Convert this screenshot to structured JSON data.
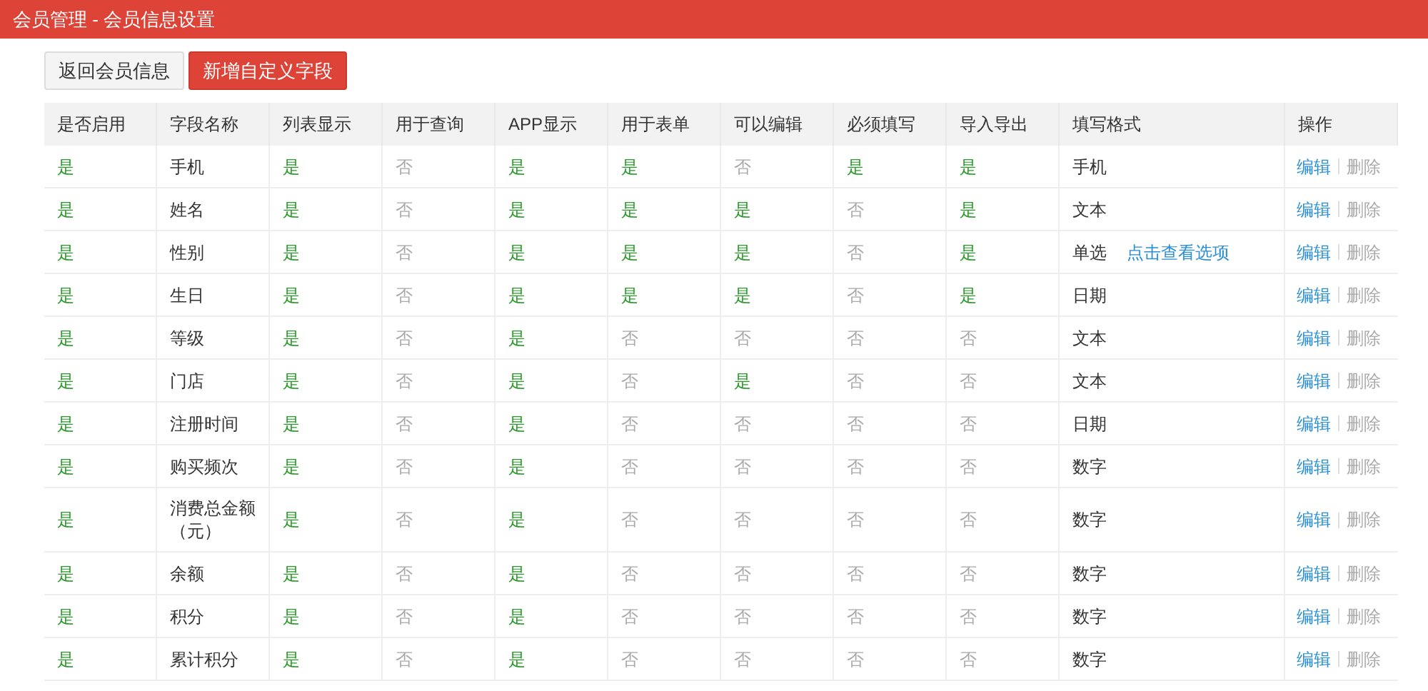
{
  "header": {
    "title": "会员管理 - 会员信息设置"
  },
  "buttons": [
    {
      "label": "返回会员信息",
      "kind": "default"
    },
    {
      "label": "新增自定义字段",
      "kind": "primary"
    }
  ],
  "table": {
    "columns": [
      "是否启用",
      "字段名称",
      "列表显示",
      "用于查询",
      "APP显示",
      "用于表单",
      "可以编辑",
      "必须填写",
      "导入导出",
      "填写格式",
      "操作"
    ],
    "rows": [
      {
        "flags_a": [
          {
            "text": "是",
            "on": true
          }
        ],
        "name": "手机",
        "flags": [
          {
            "text": "是",
            "on": true
          },
          {
            "text": "否",
            "on": false
          },
          {
            "text": "是",
            "on": true
          },
          {
            "text": "是",
            "on": true
          },
          {
            "text": "否",
            "on": false
          },
          {
            "text": "是",
            "on": true
          },
          {
            "text": "是",
            "on": true
          }
        ],
        "format": "手机",
        "actions": [
          "编辑",
          "删除"
        ]
      },
      {
        "flags_a": [
          {
            "text": "是",
            "on": true
          }
        ],
        "name": "姓名",
        "flags": [
          {
            "text": "是",
            "on": true
          },
          {
            "text": "否",
            "on": false
          },
          {
            "text": "是",
            "on": true
          },
          {
            "text": "是",
            "on": true
          },
          {
            "text": "是",
            "on": true
          },
          {
            "text": "否",
            "on": false
          },
          {
            "text": "是",
            "on": true
          }
        ],
        "format": "文本",
        "actions": [
          "编辑",
          "删除"
        ]
      },
      {
        "flags_a": [
          {
            "text": "是",
            "on": true
          }
        ],
        "name": "性别",
        "flags": [
          {
            "text": "是",
            "on": true
          },
          {
            "text": "否",
            "on": false
          },
          {
            "text": "是",
            "on": true
          },
          {
            "text": "是",
            "on": true
          },
          {
            "text": "是",
            "on": true
          },
          {
            "text": "否",
            "on": false
          },
          {
            "text": "是",
            "on": true
          }
        ],
        "format": "单选",
        "format_link": "点击查看选项",
        "actions": [
          "编辑",
          "删除"
        ]
      },
      {
        "flags_a": [
          {
            "text": "是",
            "on": true
          }
        ],
        "name": "生日",
        "flags": [
          {
            "text": "是",
            "on": true
          },
          {
            "text": "否",
            "on": false
          },
          {
            "text": "是",
            "on": true
          },
          {
            "text": "是",
            "on": true
          },
          {
            "text": "是",
            "on": true
          },
          {
            "text": "否",
            "on": false
          },
          {
            "text": "是",
            "on": true
          }
        ],
        "format": "日期",
        "actions": [
          "编辑",
          "删除"
        ]
      },
      {
        "flags_a": [
          {
            "text": "是",
            "on": true
          }
        ],
        "name": "等级",
        "flags": [
          {
            "text": "是",
            "on": true
          },
          {
            "text": "否",
            "on": false
          },
          {
            "text": "是",
            "on": true
          },
          {
            "text": "否",
            "on": false
          },
          {
            "text": "否",
            "on": false
          },
          {
            "text": "否",
            "on": false
          },
          {
            "text": "否",
            "on": false
          }
        ],
        "format": "文本",
        "actions": [
          "编辑",
          "删除"
        ]
      },
      {
        "flags_a": [
          {
            "text": "是",
            "on": true
          }
        ],
        "name": "门店",
        "flags": [
          {
            "text": "是",
            "on": true
          },
          {
            "text": "否",
            "on": false
          },
          {
            "text": "是",
            "on": true
          },
          {
            "text": "否",
            "on": false
          },
          {
            "text": "是",
            "on": true
          },
          {
            "text": "否",
            "on": false
          },
          {
            "text": "否",
            "on": false
          }
        ],
        "format": "文本",
        "actions": [
          "编辑",
          "删除"
        ]
      },
      {
        "flags_a": [
          {
            "text": "是",
            "on": true
          }
        ],
        "name": "注册时间",
        "flags": [
          {
            "text": "是",
            "on": true
          },
          {
            "text": "否",
            "on": false
          },
          {
            "text": "是",
            "on": true
          },
          {
            "text": "否",
            "on": false
          },
          {
            "text": "否",
            "on": false
          },
          {
            "text": "否",
            "on": false
          },
          {
            "text": "否",
            "on": false
          }
        ],
        "format": "日期",
        "actions": [
          "编辑",
          "删除"
        ]
      },
      {
        "flags_a": [
          {
            "text": "是",
            "on": true
          }
        ],
        "name": "购买频次",
        "flags": [
          {
            "text": "是",
            "on": true
          },
          {
            "text": "否",
            "on": false
          },
          {
            "text": "是",
            "on": true
          },
          {
            "text": "否",
            "on": false
          },
          {
            "text": "否",
            "on": false
          },
          {
            "text": "否",
            "on": false
          },
          {
            "text": "否",
            "on": false
          }
        ],
        "format": "数字",
        "actions": [
          "编辑",
          "删除"
        ]
      },
      {
        "flags_a": [
          {
            "text": "是",
            "on": true
          }
        ],
        "name": "消费总金额（元）",
        "flags": [
          {
            "text": "是",
            "on": true
          },
          {
            "text": "否",
            "on": false
          },
          {
            "text": "是",
            "on": true
          },
          {
            "text": "否",
            "on": false
          },
          {
            "text": "否",
            "on": false
          },
          {
            "text": "否",
            "on": false
          },
          {
            "text": "否",
            "on": false
          }
        ],
        "format": "数字",
        "actions": [
          "编辑",
          "删除"
        ]
      },
      {
        "flags_a": [
          {
            "text": "是",
            "on": true
          }
        ],
        "name": "余额",
        "flags": [
          {
            "text": "是",
            "on": true
          },
          {
            "text": "否",
            "on": false
          },
          {
            "text": "是",
            "on": true
          },
          {
            "text": "否",
            "on": false
          },
          {
            "text": "否",
            "on": false
          },
          {
            "text": "否",
            "on": false
          },
          {
            "text": "否",
            "on": false
          }
        ],
        "format": "数字",
        "actions": [
          "编辑",
          "删除"
        ]
      },
      {
        "flags_a": [
          {
            "text": "是",
            "on": true
          }
        ],
        "name": "积分",
        "flags": [
          {
            "text": "是",
            "on": true
          },
          {
            "text": "否",
            "on": false
          },
          {
            "text": "是",
            "on": true
          },
          {
            "text": "否",
            "on": false
          },
          {
            "text": "否",
            "on": false
          },
          {
            "text": "否",
            "on": false
          },
          {
            "text": "否",
            "on": false
          }
        ],
        "format": "数字",
        "actions": [
          "编辑",
          "删除"
        ]
      },
      {
        "flags_a": [
          {
            "text": "是",
            "on": true
          }
        ],
        "name": "累计积分",
        "flags": [
          {
            "text": "是",
            "on": true
          },
          {
            "text": "否",
            "on": false
          },
          {
            "text": "是",
            "on": true
          },
          {
            "text": "否",
            "on": false
          },
          {
            "text": "否",
            "on": false
          },
          {
            "text": "否",
            "on": false
          },
          {
            "text": "否",
            "on": false
          }
        ],
        "format": "数字",
        "actions": [
          "编辑",
          "删除"
        ]
      }
    ]
  }
}
